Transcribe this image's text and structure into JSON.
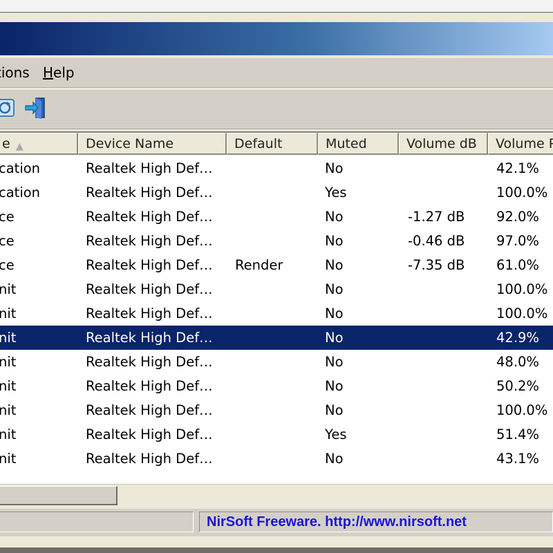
{
  "menu": {
    "options_label": "tions",
    "help_label_u": "H",
    "help_label_rest": "elp"
  },
  "toolbar": {
    "buttons": [
      {
        "icon": "refresh-icon"
      },
      {
        "icon": "exit-icon"
      }
    ]
  },
  "list": {
    "columns": [
      {
        "key": "name",
        "label": "e"
      },
      {
        "key": "device_name",
        "label": "Device Name"
      },
      {
        "key": "default",
        "label": "Default"
      },
      {
        "key": "muted",
        "label": "Muted"
      },
      {
        "key": "volume_db",
        "label": "Volume dB"
      },
      {
        "key": "volume_pct",
        "label": "Volume P"
      }
    ],
    "rows": [
      {
        "name": "cation",
        "device": "Realtek High Def…",
        "default": "",
        "muted": "No",
        "db": "",
        "vol": "42.1%"
      },
      {
        "name": "cation",
        "device": "Realtek High Def…",
        "default": "",
        "muted": "Yes",
        "db": "",
        "vol": "100.0%"
      },
      {
        "name": "ce",
        "device": "Realtek High Def…",
        "default": "",
        "muted": "No",
        "db": "-1.27 dB",
        "vol": "92.0%"
      },
      {
        "name": "ce",
        "device": "Realtek High Def…",
        "default": "",
        "muted": "No",
        "db": "-0.46 dB",
        "vol": "97.0%"
      },
      {
        "name": "ce",
        "device": "Realtek High Def…",
        "default": "Render",
        "muted": "No",
        "db": "-7.35 dB",
        "vol": "61.0%"
      },
      {
        "name": "nit",
        "device": "Realtek High Def…",
        "default": "",
        "muted": "No",
        "db": "",
        "vol": "100.0%"
      },
      {
        "name": "nit",
        "device": "Realtek High Def…",
        "default": "",
        "muted": "No",
        "db": "",
        "vol": "100.0%"
      },
      {
        "name": "nit",
        "device": "Realtek High Def…",
        "default": "",
        "muted": "No",
        "db": "",
        "vol": "42.9%",
        "selected": true
      },
      {
        "name": "nit",
        "device": "Realtek High Def…",
        "default": "",
        "muted": "No",
        "db": "",
        "vol": "48.0%"
      },
      {
        "name": "nit",
        "device": "Realtek High Def…",
        "default": "",
        "muted": "No",
        "db": "",
        "vol": "50.2%"
      },
      {
        "name": "nit",
        "device": "Realtek High Def…",
        "default": "",
        "muted": "No",
        "db": "",
        "vol": "100.0%"
      },
      {
        "name": "nit",
        "device": "Realtek High Def…",
        "default": "",
        "muted": "Yes",
        "db": "",
        "vol": "51.4%"
      },
      {
        "name": "nit",
        "device": "Realtek High Def…",
        "default": "",
        "muted": "No",
        "db": "",
        "vol": "43.1%"
      }
    ]
  },
  "status": {
    "left_text": "",
    "right_text": "NirSoft Freeware.  http://www.nirsoft.net"
  },
  "colors": {
    "selection": "#0a246a",
    "link_text": "#1a14d8",
    "titlebar_start": "#0a246a",
    "titlebar_end": "#a6caf0"
  }
}
